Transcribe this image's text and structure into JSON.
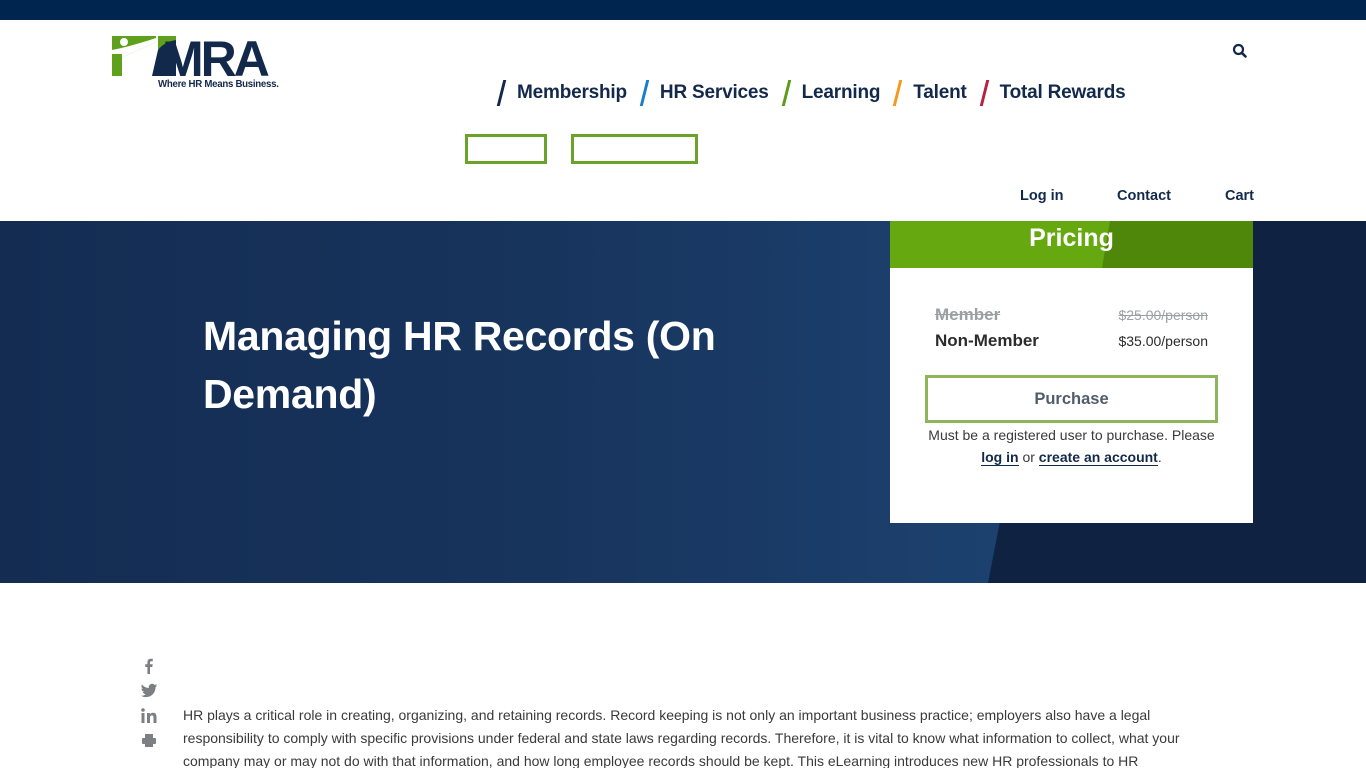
{
  "brand": {
    "logo_text": "MRA",
    "tagline": "Where HR Means Business.",
    "colors": {
      "navy": "#13294b",
      "green": "#65a80f",
      "top_bar": "#00264f"
    }
  },
  "header": {
    "search_icon": "search-icon",
    "main_nav": [
      {
        "label": "Membership",
        "accent": "#13294b"
      },
      {
        "label": "HR Services",
        "accent": "#1a7dc9"
      },
      {
        "label": "Learning",
        "accent": "#5c9a1c"
      },
      {
        "label": "Talent",
        "accent": "#f39a1e"
      },
      {
        "label": "Total Rewards",
        "accent": "#b5213f"
      }
    ],
    "utility_nav": [
      "Log in",
      "Contact",
      "Cart"
    ]
  },
  "hero": {
    "title": "Managing HR Records (On Demand)"
  },
  "pricing": {
    "title": "Pricing",
    "rows": [
      {
        "label": "Member",
        "value": "$25.00/person",
        "struck": true
      },
      {
        "label": "Non-Member",
        "value": "$35.00/person",
        "struck": false
      }
    ],
    "purchase_label": "Purchase",
    "note_prefix": "Must be a registered user to purchase. Please",
    "login_link": "log in",
    "note_or": "or",
    "create_link": "create an account",
    "note_suffix": "."
  },
  "share": {
    "icons": [
      "facebook-icon",
      "twitter-icon",
      "linkedin-icon",
      "print-icon"
    ]
  },
  "content": {
    "intro": "HR plays a critical role in creating, organizing, and retaining records. Record keeping is not only an important business practice; employers also have a legal responsibility to comply with specific provisions under federal and state laws regarding records. Therefore, it is vital to know what information to collect, what your company may or may not do with that information, and how long employee records should be kept. This eLearning introduces new HR professionals to HR"
  }
}
